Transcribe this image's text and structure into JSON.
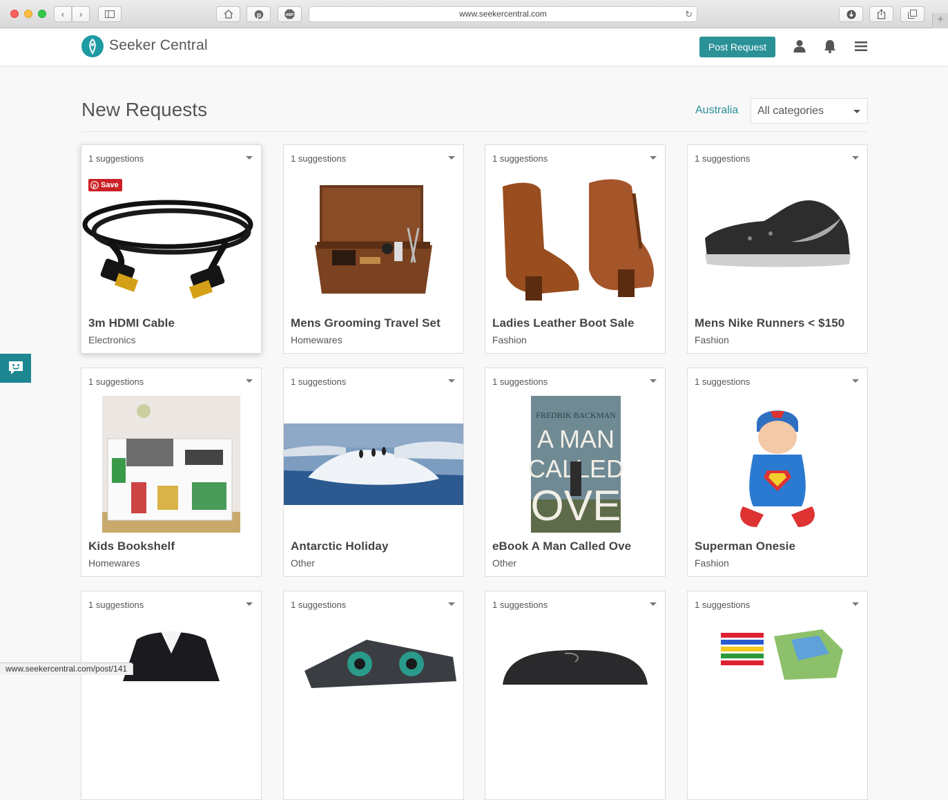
{
  "browser": {
    "url": "www.seekercentral.com",
    "status_url": "www.seekercentral.com/post/141"
  },
  "header": {
    "brand": "Seeker Central",
    "post_button": "Post Request",
    "brand_color": "#2a9197"
  },
  "main": {
    "title": "New Requests",
    "location": "Australia",
    "category_filter": "All categories"
  },
  "cards": [
    {
      "suggestions": "1 suggestions",
      "title": "3m HDMI Cable",
      "category": "Electronics",
      "image": "hdmi-cable-image",
      "save_label": "Save"
    },
    {
      "suggestions": "1 suggestions",
      "title": "Mens Grooming Travel Set",
      "category": "Homewares",
      "image": "grooming-box-image"
    },
    {
      "suggestions": "1 suggestions",
      "title": "Ladies Leather Boot Sale",
      "category": "Fashion",
      "image": "leather-boots-image"
    },
    {
      "suggestions": "1 suggestions",
      "title": "Mens Nike Runners < $150",
      "category": "Fashion",
      "image": "nike-runner-image"
    },
    {
      "suggestions": "1 suggestions",
      "title": "Kids Bookshelf",
      "category": "Homewares",
      "image": "bookshelf-image"
    },
    {
      "suggestions": "1 suggestions",
      "title": "Antarctic Holiday",
      "category": "Other",
      "image": "antarctic-image"
    },
    {
      "suggestions": "1 suggestions",
      "title": "eBook A Man Called Ove",
      "category": "Other",
      "image": "book-cover-image",
      "book_author": "FREDRIK BACKMAN",
      "book_title": "A MAN CALLED OVE"
    },
    {
      "suggestions": "1 suggestions",
      "title": "Superman Onesie",
      "category": "Fashion",
      "image": "superman-baby-image"
    },
    {
      "suggestions": "1 suggestions",
      "title": "",
      "category": "",
      "image": "blazer-image"
    },
    {
      "suggestions": "1 suggestions",
      "title": "",
      "category": "",
      "image": "graphics-card-image"
    },
    {
      "suggestions": "1 suggestions",
      "title": "",
      "category": "",
      "image": "power-bank-image"
    },
    {
      "suggestions": "1 suggestions",
      "title": "",
      "category": "",
      "image": "crayons-puzzle-image"
    }
  ]
}
